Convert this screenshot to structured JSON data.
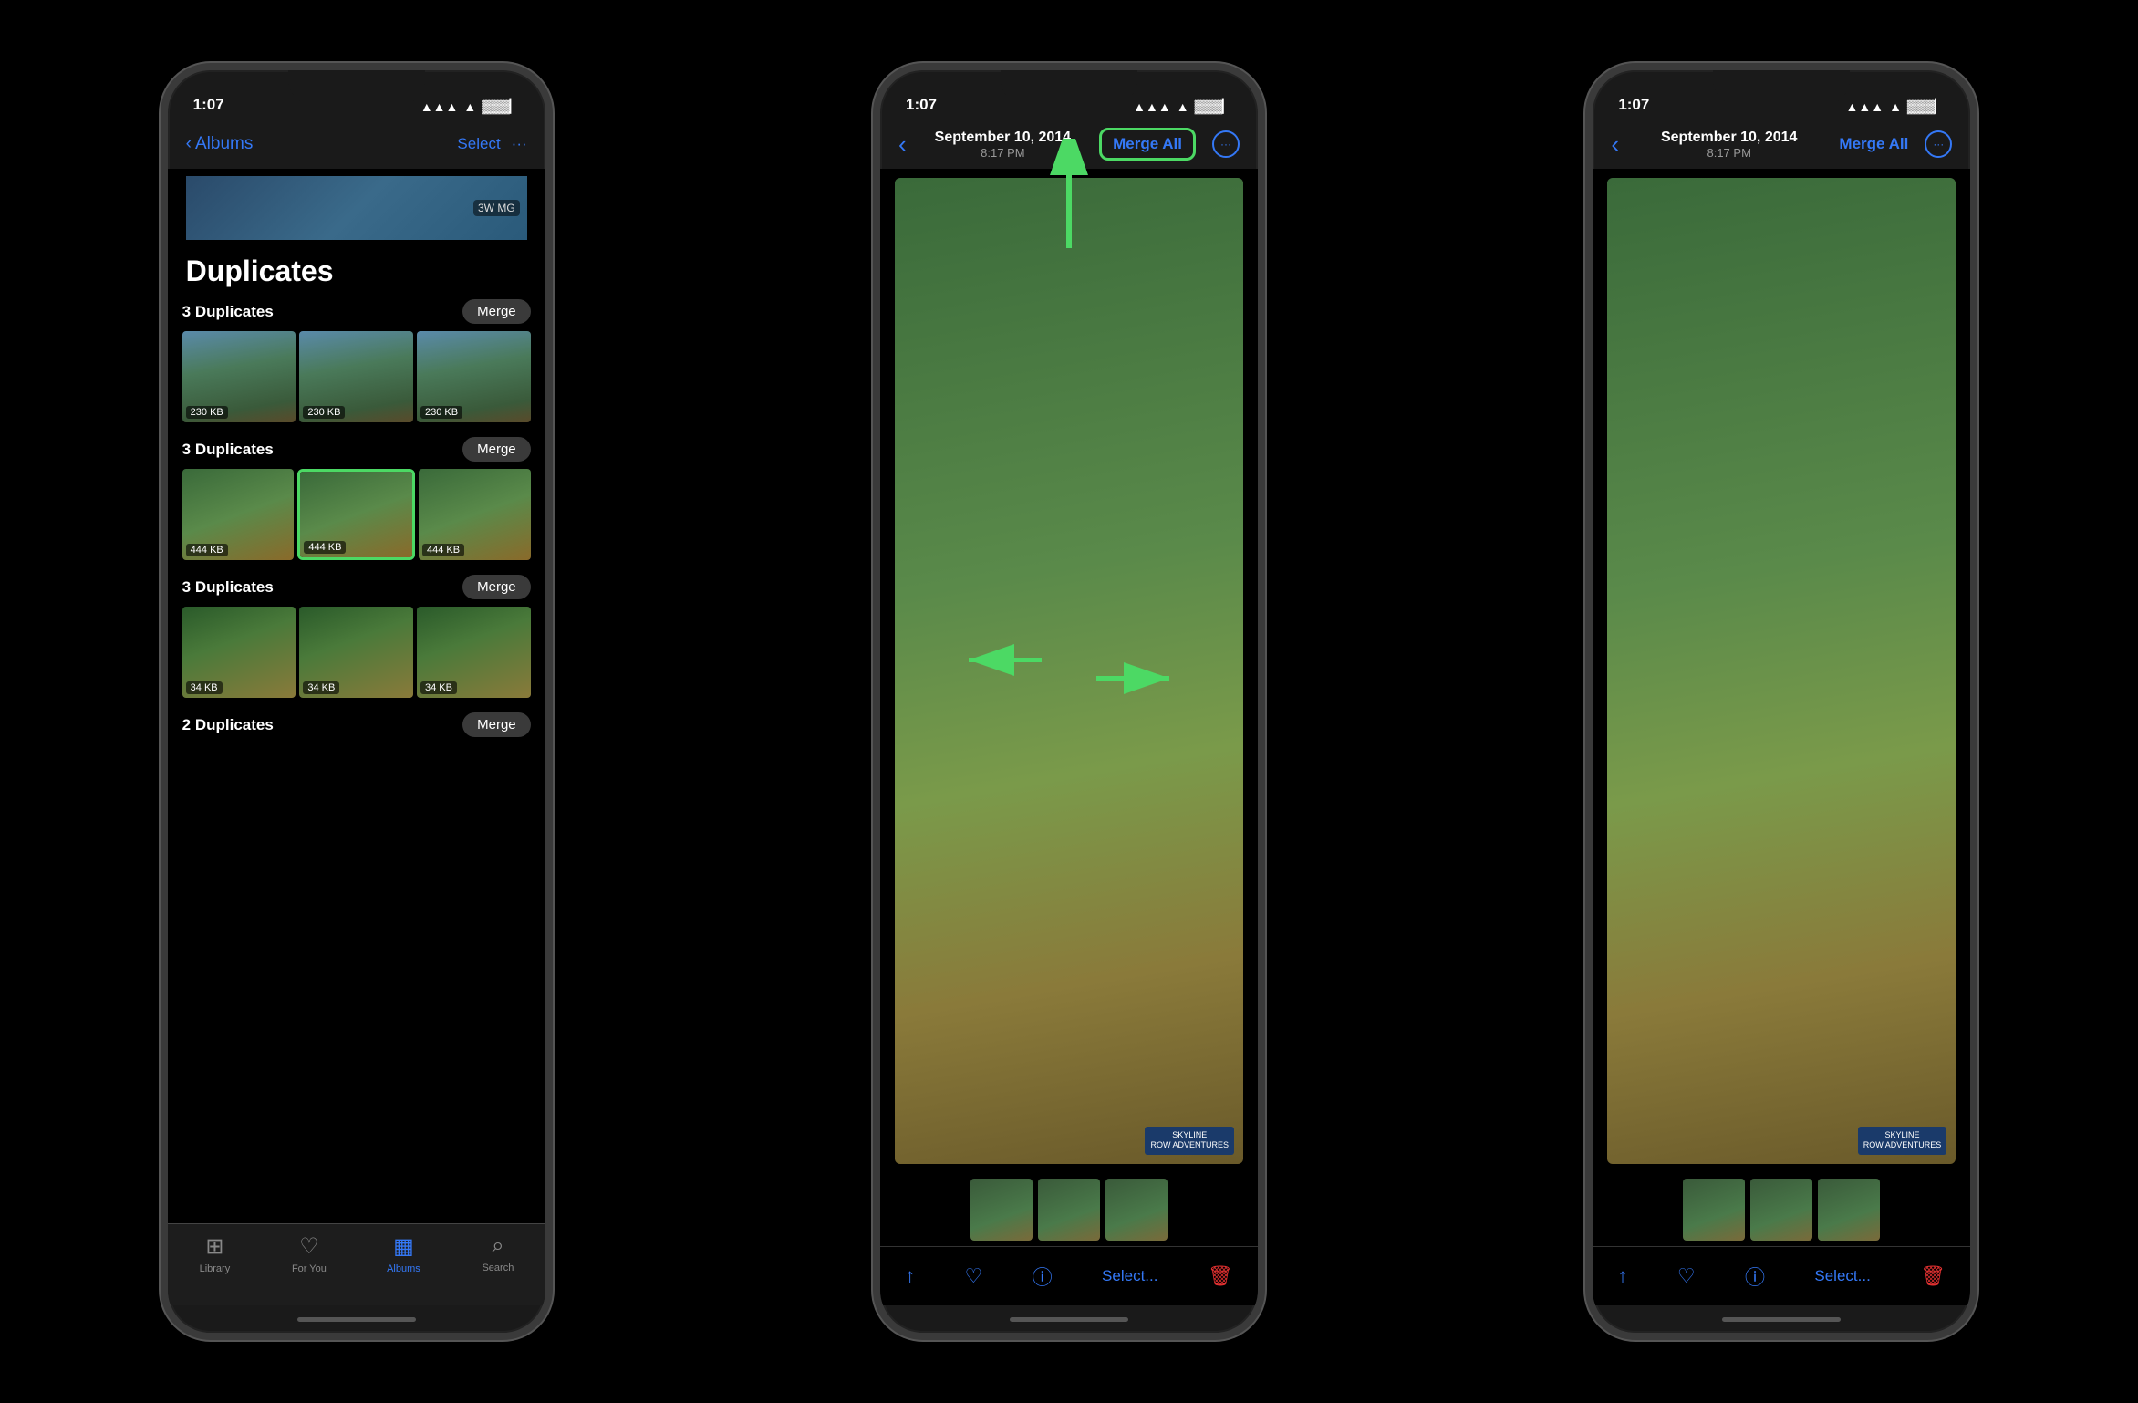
{
  "phones": {
    "phone1": {
      "statusBar": {
        "time": "1:07",
        "signal": "●●●▲",
        "wifi": "wifi",
        "battery": "battery"
      },
      "nav": {
        "back": "Albums",
        "title": "Duplicates",
        "select": "Select",
        "dots": "···"
      },
      "groups": [
        {
          "label": "3 Duplicates",
          "mergeBtn": "Merge",
          "photos": [
            {
              "size": "230 KB",
              "type": "people"
            },
            {
              "size": "230 KB",
              "type": "people"
            },
            {
              "size": "230 KB",
              "type": "people"
            }
          ]
        },
        {
          "label": "3 Duplicates",
          "mergeBtn": "Merge",
          "highlighted": true,
          "photos": [
            {
              "size": "444 KB",
              "type": "zipline"
            },
            {
              "size": "444 KB",
              "type": "zipline",
              "selected": true
            },
            {
              "size": "444 KB",
              "type": "zipline"
            }
          ]
        },
        {
          "label": "3 Duplicates",
          "mergeBtn": "Merge",
          "photos": [
            {
              "size": "34 KB",
              "type": "zipline-small"
            },
            {
              "size": "34 KB",
              "type": "zipline-small"
            },
            {
              "size": "34 KB",
              "type": "zipline-small"
            }
          ]
        },
        {
          "label": "2 Duplicates",
          "mergeBtn": "Merge",
          "photos": []
        }
      ],
      "tabBar": {
        "items": [
          {
            "label": "Library",
            "icon": "🖼",
            "active": false
          },
          {
            "label": "For You",
            "icon": "❤",
            "active": false
          },
          {
            "label": "Albums",
            "icon": "📋",
            "active": true
          },
          {
            "label": "Search",
            "icon": "🔍",
            "active": false
          }
        ]
      }
    },
    "phone2": {
      "statusBar": {
        "time": "1:07"
      },
      "nav": {
        "back": "‹",
        "dateTitle": "September 10, 2014",
        "timeSub": "8:17 PM",
        "mergeAll": "Merge All",
        "mergeAllHighlighted": true,
        "dots": "···"
      },
      "toolbar": {
        "share": "share",
        "heart": "heart",
        "info": "info",
        "select": "Select...",
        "trash": "trash"
      }
    },
    "phone3": {
      "statusBar": {
        "time": "1:07"
      },
      "nav": {
        "back": "‹",
        "dateTitle": "September 10, 2014",
        "timeSub": "8:17 PM",
        "mergeAll": "Merge All",
        "dots": "···"
      },
      "toolbar": {
        "share": "share",
        "heart": "heart",
        "info": "info",
        "select": "Select...",
        "trash": "trash"
      }
    }
  }
}
